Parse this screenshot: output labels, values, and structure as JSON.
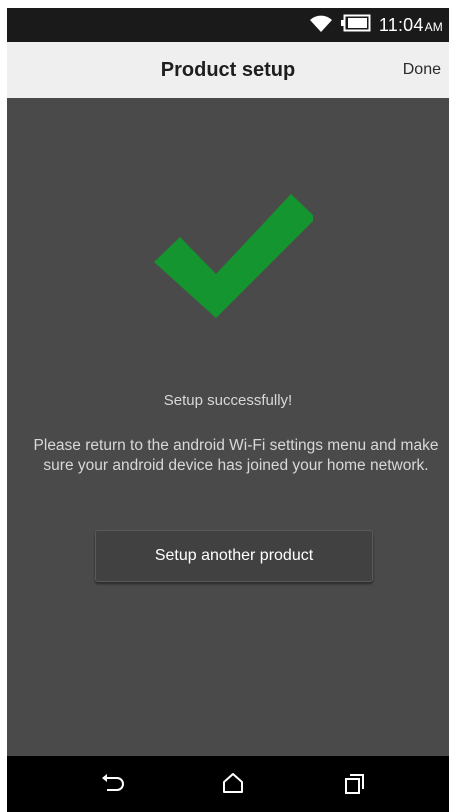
{
  "status_bar": {
    "time": "11:04",
    "ampm": "AM",
    "icons": [
      "wifi-icon",
      "battery-icon"
    ]
  },
  "header": {
    "title": "Product setup",
    "done_label": "Done"
  },
  "main": {
    "success_icon": "checkmark-icon",
    "success_message": "Setup successfully!",
    "instructions": "Please return to the android Wi-Fi settings menu and make sure your android device has joined your home network.",
    "setup_another_label": "Setup another product"
  },
  "nav_bar": {
    "buttons": [
      "back-icon",
      "home-icon",
      "recents-icon"
    ]
  },
  "colors": {
    "check_green": "#14952f",
    "background": "#4a4a4a",
    "title_bar": "#efefef",
    "status_bar": "#1a1a1a"
  }
}
